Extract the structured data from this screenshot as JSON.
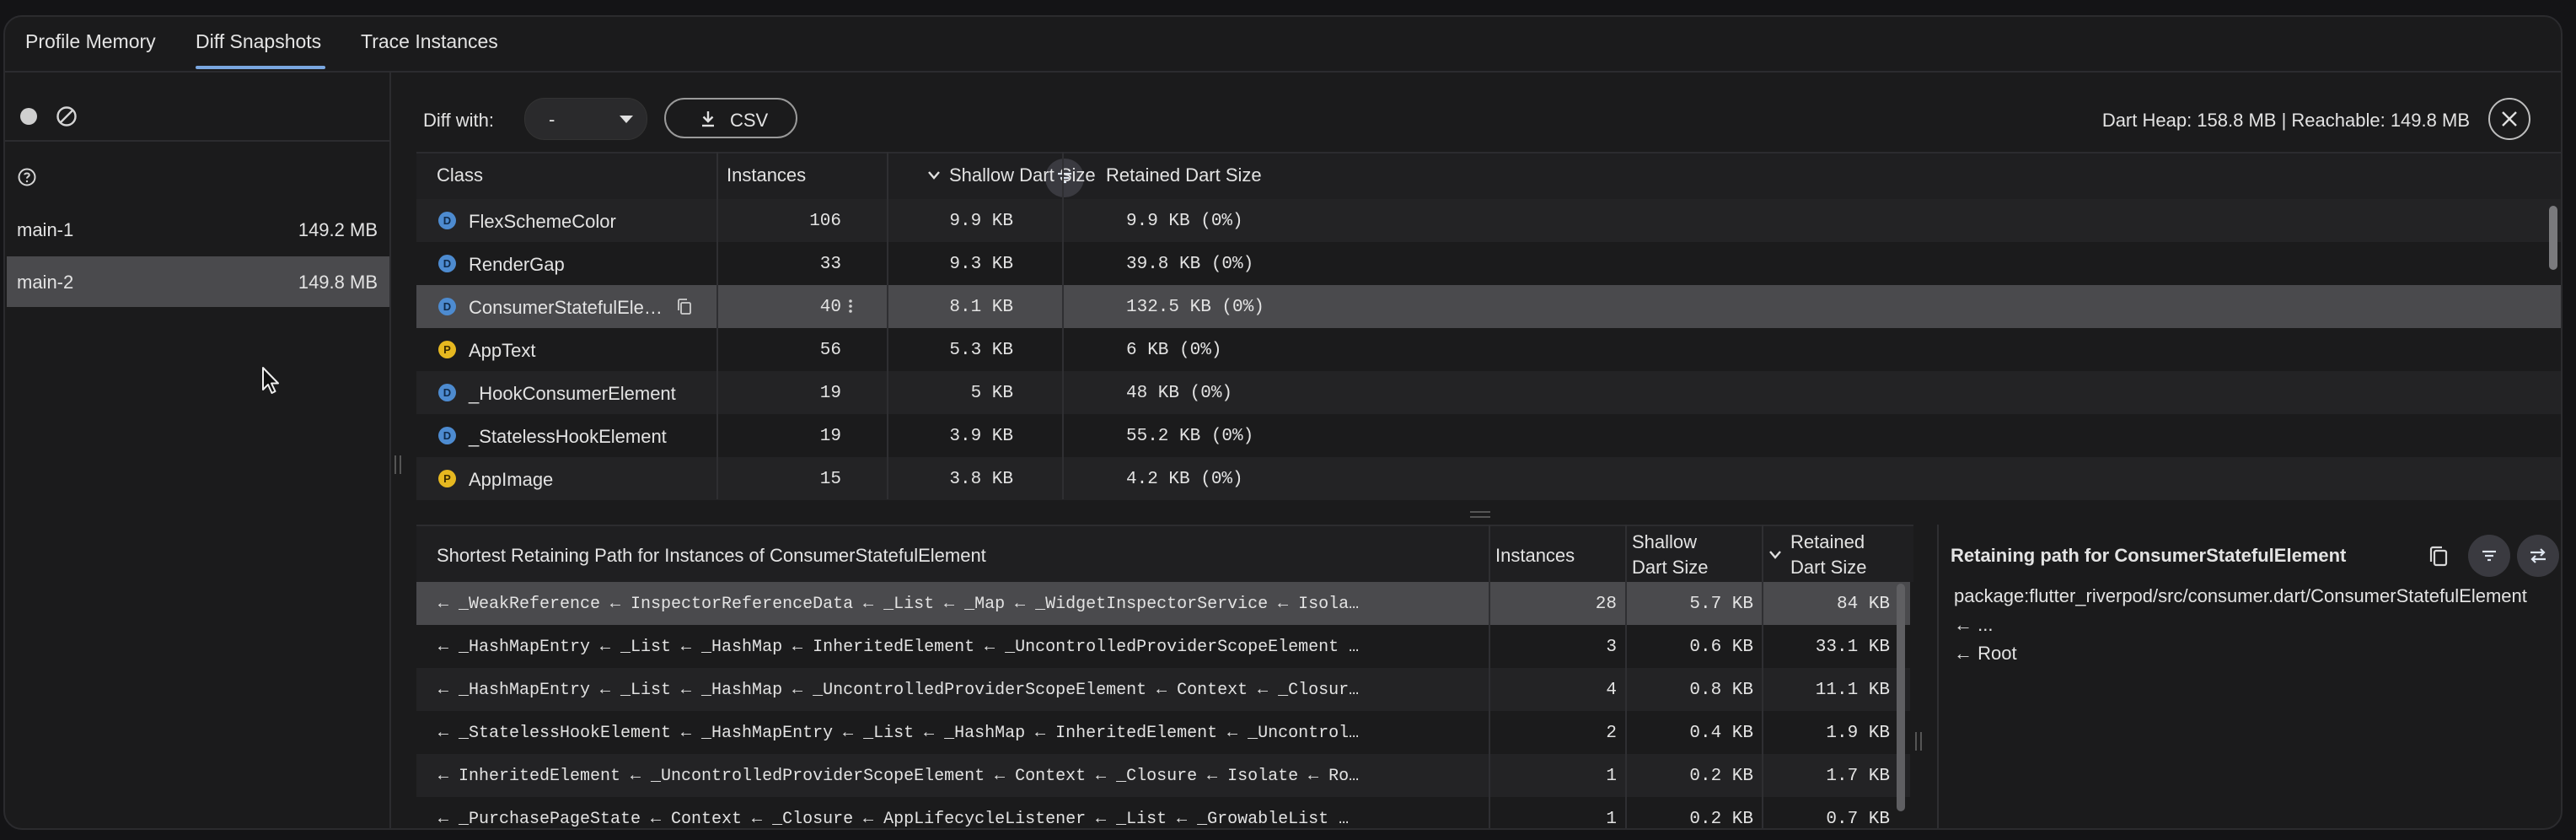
{
  "tabs": [
    {
      "label": "Profile Memory"
    },
    {
      "label": "Diff Snapshots"
    },
    {
      "label": "Trace Instances"
    }
  ],
  "snapshots": [
    {
      "name": "main-1",
      "size": "149.2 MB"
    },
    {
      "name": "main-2",
      "size": "149.8 MB"
    }
  ],
  "toolbar": {
    "diff_with_label": "Diff with:",
    "diff_with_value": "-",
    "csv_label": "CSV",
    "heap_info": "Dart Heap: 158.8 MB | Reachable: 149.8 MB"
  },
  "class_table": {
    "headers": {
      "class": "Class",
      "instances": "Instances",
      "shallow": "Shallow Dart Size",
      "retained": "Retained Dart Size"
    },
    "rows": [
      {
        "icon": "D",
        "name": "FlexSchemeColor",
        "instances": "106",
        "shallow": "9.9 KB",
        "retained": "9.9 KB (0%)"
      },
      {
        "icon": "D",
        "name": "RenderGap",
        "instances": "33",
        "shallow": "9.3 KB",
        "retained": "39.8 KB (0%)"
      },
      {
        "icon": "D",
        "name": "ConsumerStatefulEle…",
        "instances": "40",
        "shallow": "8.1 KB",
        "retained": "132.5 KB (0%)"
      },
      {
        "icon": "P",
        "name": "AppText",
        "instances": "56",
        "shallow": "5.3 KB",
        "retained": "6 KB (0%)"
      },
      {
        "icon": "D",
        "name": "_HookConsumerElement",
        "instances": "19",
        "shallow": "5 KB",
        "retained": "48 KB (0%)"
      },
      {
        "icon": "D",
        "name": "_StatelessHookElement",
        "instances": "19",
        "shallow": "3.9 KB",
        "retained": "55.2 KB (0%)"
      },
      {
        "icon": "P",
        "name": "AppImage",
        "instances": "15",
        "shallow": "3.8 KB",
        "retained": "4.2 KB (0%)"
      }
    ]
  },
  "path_table": {
    "title": "Shortest Retaining Path for Instances of ConsumerStatefulElement",
    "headers": {
      "instances": "Instances",
      "shallow_1": "Shallow",
      "shallow_2": "Dart Size",
      "retained_1": "Retained",
      "retained_2": "Dart Size"
    },
    "rows": [
      {
        "path": "← _WeakReference ← InspectorReferenceData ← _List ← _Map ← _WidgetInspectorService ← Isola…",
        "instances": "28",
        "shallow": "5.7 KB",
        "retained": "84 KB"
      },
      {
        "path": "← _HashMapEntry ← _List ← _HashMap ← InheritedElement ← _UncontrolledProviderScopeElement …",
        "instances": "3",
        "shallow": "0.6 KB",
        "retained": "33.1 KB"
      },
      {
        "path": "← _HashMapEntry ← _List ← _HashMap ← _UncontrolledProviderScopeElement ← Context ← _Closur…",
        "instances": "4",
        "shallow": "0.8 KB",
        "retained": "11.1 KB"
      },
      {
        "path": "← _StatelessHookElement ← _HashMapEntry ← _List ← _HashMap ← InheritedElement ← _Uncontrol…",
        "instances": "2",
        "shallow": "0.4 KB",
        "retained": "1.9 KB"
      },
      {
        "path": "← InheritedElement ← _UncontrolledProviderScopeElement ← Context ← _Closure ← Isolate ← Ro…",
        "instances": "1",
        "shallow": "0.2 KB",
        "retained": "1.7 KB"
      },
      {
        "path": "← _PurchasePageState ← Context ← _Closure ← AppLifecycleListener ← _List ← _GrowableList …",
        "instances": "1",
        "shallow": "0.2 KB",
        "retained": "0.7 KB"
      }
    ]
  },
  "retaining_panel": {
    "title": "Retaining path for ConsumerStatefulElement",
    "lines": [
      "package:flutter_riverpod/src/consumer.dart/ConsumerStatefulElement",
      "← ...",
      "← Root"
    ]
  },
  "colors": {
    "accent": "#7aa7e0",
    "selected_row": "#4a4a4d",
    "dart_class": "#4d8bd0",
    "package_class": "#e6b820"
  }
}
